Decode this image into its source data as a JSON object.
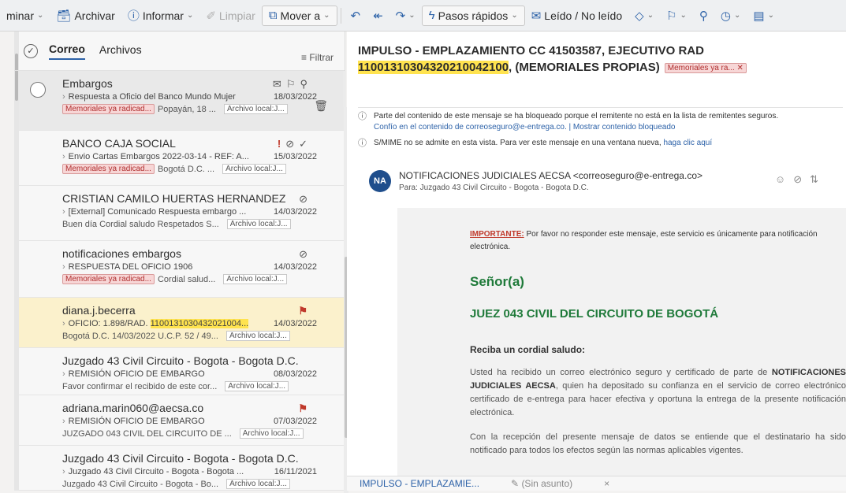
{
  "toolbar": {
    "items": [
      {
        "label": "minar",
        "icon": "delete-icon"
      },
      {
        "label": "Archivar",
        "icon": "archive-icon"
      },
      {
        "label": "Informar",
        "icon": "report-icon"
      },
      {
        "label": "Limpiar",
        "icon": "sweep-icon"
      },
      {
        "label": "Mover a",
        "icon": "move-icon"
      },
      {
        "label": "Pasos rápidos",
        "icon": "lightning-icon"
      },
      {
        "label": "Leído / No leído",
        "icon": "envelope-icon"
      }
    ]
  },
  "list": {
    "tabs": [
      "Correo",
      "Archivos"
    ],
    "filter": "Filtrar",
    "messages": [
      {
        "sender": "Embargos",
        "subject": "Respuesta a Oficio del Banco Mundo Mujer",
        "date": "18/03/2022",
        "category": "Memoriales ya radicad...",
        "preview": "Popayán, 18 ...",
        "archive": "Archivo local:J..."
      },
      {
        "sender": "BANCO CAJA SOCIAL",
        "subject": "Envio Cartas Embargos 2022-03-14 - REF: A...",
        "date": "15/03/2022",
        "category": "Memoriales ya radicad...",
        "preview": "Bogotá D.C. ...",
        "archive": "Archivo local:J..."
      },
      {
        "sender": "CRISTIAN CAMILO HUERTAS HERNANDEZ",
        "subject": "[External] Comunicado Respuesta embargo ...",
        "date": "14/03/2022",
        "category": "",
        "preview": "Buen día Cordial saludo Respetados S...",
        "archive": "Archivo local:J..."
      },
      {
        "sender": "notificaciones embargos",
        "subject": "RESPUESTA DEL OFICIO 1906",
        "date": "14/03/2022",
        "category": "Memoriales ya radicad...",
        "preview": "Cordial salud...",
        "archive": "Archivo local:J..."
      },
      {
        "sender": "diana.j.becerra",
        "subject_prefix": "OFICIO: 1.898/RAD.",
        "subject_hl": "1100131030432021004...",
        "date": "14/03/2022",
        "category": "",
        "preview": "Bogotá D.C. 14/03/2022 U.C.P. 52 / 49...",
        "archive": "Archivo local:J..."
      },
      {
        "sender": "Juzgado 43 Civil Circuito - Bogota - Bogota D.C.",
        "subject": "REMISIÓN OFICIO DE EMBARGO",
        "date": "08/03/2022",
        "category": "",
        "preview": "Favor confirmar el recibido de este cor...",
        "archive": "Archivo local:J..."
      },
      {
        "sender": "adriana.marin060@aecsa.co",
        "subject": "REMISIÓN OFICIO DE EMBARGO",
        "date": "07/03/2022",
        "category": "",
        "preview": "JUZGADO 043 CIVIL DEL CIRCUITO DE ...",
        "archive": "Archivo local:J..."
      },
      {
        "sender": "Juzgado 43 Civil Circuito - Bogota - Bogota D.C.",
        "subject": "Juzgado 43 Civil Circuito - Bogota - Bogota ...",
        "date": "16/11/2021",
        "category": "",
        "preview": "Juzgado 43 Civil Circuito - Bogota - Bo...",
        "archive": "Archivo local:J..."
      }
    ]
  },
  "reading": {
    "title_prefix": "IMPULSO - EMPLAZAMIENTO CC 41503587, EJECUTIVO RAD ",
    "title_hl": "11001310304320210042100",
    "title_suffix": ", (MEMORIALES PROPIAS)",
    "category": "Memoriales ya ra...",
    "warn1": "Parte del contenido de este mensaje se ha bloqueado porque el remitente no está en la lista de remitentes seguros.",
    "warn1_link": "Confío en el contenido de correoseguro@e-entrega.co. | Mostrar contenido bloqueado",
    "warn2": "S/MIME no se admite en esta vista. Para ver este mensaje en una ventana nueva,",
    "warn2_link": "haga clic aquí",
    "avatar": "NA",
    "from": "NOTIFICACIONES JUDICIALES AECSA <correoseguro@e-entrega.co>",
    "to": "Para: Juzgado 43 Civil Circuito - Bogota - Bogota D.C.",
    "imp_label": "IMPORTANTE:",
    "imp_text": " Por favor no responder este mensaje, este servicio es únicamente para notificación electrónica.",
    "senor": "Señor(a)",
    "juez": "JUEZ 043 CIVIL DEL CIRCUITO DE BOGOTÁ",
    "greeting": "Reciba un cordial saludo:",
    "p1a": "Usted ha recibido un correo electrónico seguro y certificado de parte de ",
    "p1b": "NOTIFICACIONES JUDICIALES AECSA",
    "p1c": ", quien ha depositado su confianza en el servicio de correo electrónico certificado de e-entrega para hacer efectiva y oportuna la entrega de la presente notificación electrónica.",
    "p2": "Con la recepción del presente mensaje de datos se entiende que el destinatario ha sido notificado para todos los efectos según las normas aplicables vigentes."
  },
  "bottom": {
    "draft1": "IMPULSO - EMPLAZAMIE...",
    "draft2": "(Sin asunto)",
    "close": "×"
  }
}
